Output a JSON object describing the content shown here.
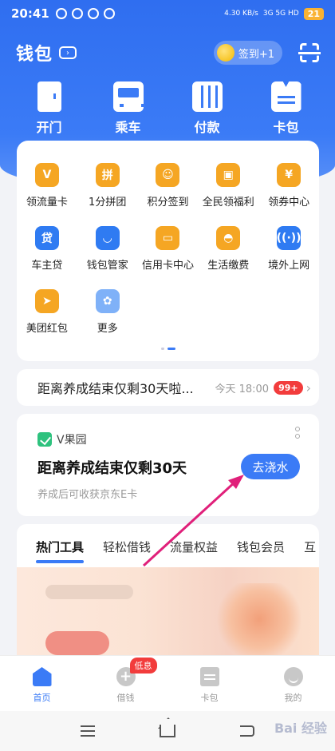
{
  "status_bar": {
    "time": "20:41",
    "net_speed": "4.30 KB/s",
    "signal": "3G 5G HD",
    "battery": "21"
  },
  "header": {
    "title": "钱包",
    "signin_label": "签到+1"
  },
  "quick_actions": [
    {
      "label": "开门",
      "icon": "door-icon"
    },
    {
      "label": "乘车",
      "icon": "bus-icon"
    },
    {
      "label": "付款",
      "icon": "barcode-icon"
    },
    {
      "label": "卡包",
      "icon": "card-holder-icon"
    }
  ],
  "services": [
    {
      "label": "领流量卡",
      "icon": "v-card-icon",
      "color": "#f5a623",
      "glyph": "V"
    },
    {
      "label": "1分拼团",
      "icon": "group-buy-icon",
      "color": "#f5a623",
      "glyph": "拼"
    },
    {
      "label": "积分签到",
      "icon": "points-icon",
      "color": "#f5a623",
      "glyph": "☺"
    },
    {
      "label": "全民领福利",
      "icon": "gift-icon",
      "color": "#f5a623",
      "glyph": "▣"
    },
    {
      "label": "领券中心",
      "icon": "coupon-icon",
      "color": "#f5a623",
      "glyph": "¥"
    },
    {
      "label": "车主贷",
      "icon": "car-loan-icon",
      "color": "#2f7bf2",
      "glyph": "贷"
    },
    {
      "label": "钱包管家",
      "icon": "butler-icon",
      "color": "#2f7bf2",
      "glyph": "◡"
    },
    {
      "label": "信用卡中心",
      "icon": "credit-card-icon",
      "color": "#f5a623",
      "glyph": "▭"
    },
    {
      "label": "生活缴费",
      "icon": "utility-icon",
      "color": "#f5a623",
      "glyph": "◓"
    },
    {
      "label": "境外上网",
      "icon": "roaming-icon",
      "color": "#2f7bf2",
      "glyph": "((·))"
    },
    {
      "label": "美团红包",
      "icon": "meituan-icon",
      "color": "#f5a623",
      "glyph": "➤"
    },
    {
      "label": "更多",
      "icon": "more-grid-icon",
      "color": "#7fb1f8",
      "glyph": "✿"
    }
  ],
  "notice": {
    "text": "距离养成结束仅剩30天啦...",
    "time": "今天 18:00",
    "badge": "99+"
  },
  "orchard": {
    "brand": "V果园",
    "title": "距离养成结束仅剩30天",
    "subtitle": "养成后可收获京东E卡",
    "button": "去浇水"
  },
  "tools": {
    "tabs": [
      "热门工具",
      "轻松借钱",
      "流量权益",
      "钱包会员",
      "互"
    ],
    "active_tab": 0
  },
  "bottom_nav": [
    {
      "label": "首页",
      "icon": "home-icon",
      "active": true
    },
    {
      "label": "借钱",
      "icon": "borrow-icon",
      "active": false,
      "badge": "低息"
    },
    {
      "label": "卡包",
      "icon": "wallet-icon",
      "active": false
    },
    {
      "label": "我的",
      "icon": "profile-icon",
      "active": false
    }
  ],
  "colors": {
    "brand_blue": "#3b7bf6",
    "accent_orange": "#f5a623",
    "badge_red": "#f23c3c",
    "annotation_arrow": "#e0207a"
  },
  "watermark": "Bai 经验"
}
